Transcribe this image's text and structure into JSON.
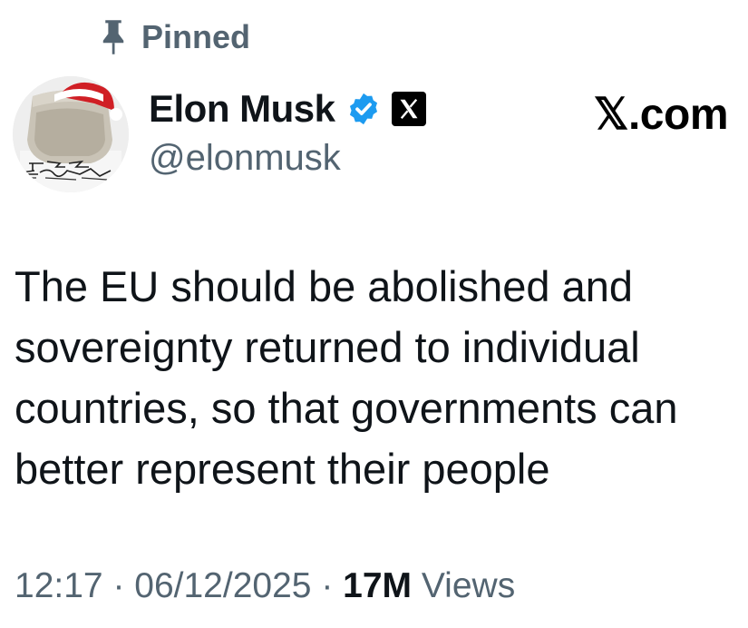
{
  "pinned": {
    "label": "Pinned",
    "icon": "pin-icon"
  },
  "author": {
    "display_name": "Elon Musk",
    "handle": "@elonmusk",
    "verified_icon": "verified-badge-icon",
    "affiliate_icon": "x-logo-badge-icon"
  },
  "watermark": "𝕏.com",
  "tweet": {
    "text_lines": [
      "The EU should be abolished and",
      "sovereignty returned to individual",
      "countries, so that governments can",
      "better represent their people"
    ]
  },
  "meta": {
    "time": "12:17",
    "date": "06/12/2025",
    "separator": " · ",
    "views_count": "17M",
    "views_label": " Views"
  },
  "colors": {
    "text_primary": "#0f1419",
    "text_secondary": "#536471",
    "verified_blue": "#1d9bf0"
  }
}
